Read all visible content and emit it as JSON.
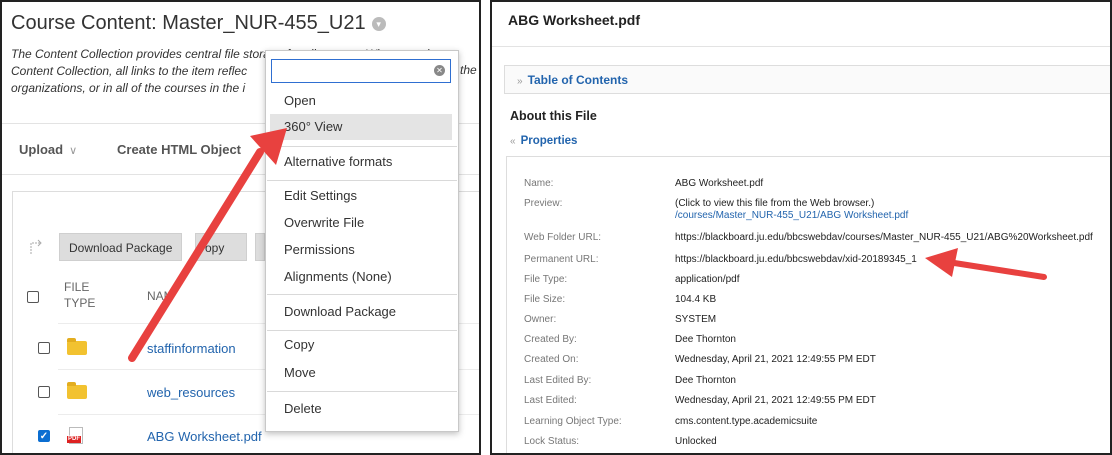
{
  "left_panel": {
    "title": "Course Content: Master_NUR-455_U21",
    "description_lines": [
      "The Content Collection provides central file storage for all content. When creating c",
      "Content Collection, all links to the item reflec",
      "organizations, or in all of the courses in the i"
    ],
    "description_tail_2": "the",
    "toolbar": {
      "upload": "Upload",
      "create_html": "Create HTML Object"
    },
    "actions": {
      "download_package": "Download Package",
      "copy": "opy"
    },
    "table_header": {
      "file_type_1": "FILE",
      "file_type_2": "TYPE",
      "name": "NAM"
    },
    "rows": [
      {
        "name": "staffinformation",
        "type": "folder",
        "checked": false
      },
      {
        "name": "web_resources",
        "type": "folder",
        "checked": false
      },
      {
        "name": "ABG Worksheet.pdf",
        "type": "pdf",
        "checked": true
      }
    ]
  },
  "context_menu": {
    "search_value": "",
    "items": {
      "open": "Open",
      "view_360": "360° View",
      "alternative_formats": "Alternative formats",
      "edit_settings": "Edit Settings",
      "overwrite_file": "Overwrite File",
      "permissions": "Permissions",
      "alignments": "Alignments (None)",
      "download_package": "Download Package",
      "copy": "Copy",
      "move": "Move",
      "delete": "Delete"
    }
  },
  "right_panel": {
    "title": "ABG Worksheet.pdf",
    "toc": "Table of Contents",
    "about": "About this File",
    "properties": "Properties",
    "fields": {
      "name_label": "Name:",
      "name_value": "ABG Worksheet.pdf",
      "preview_label": "Preview:",
      "preview_note": "(Click to view this file from the Web browser.)",
      "preview_link": "/courses/Master_NUR-455_U21/ABG Worksheet.pdf",
      "web_folder_label": "Web Folder URL:",
      "web_folder_value": "https://blackboard.ju.edu/bbcswebdav/courses/Master_NUR-455_U21/ABG%20Worksheet.pdf",
      "permanent_label": "Permanent URL:",
      "permanent_value": "https://blackboard.ju.edu/bbcswebdav/xid-20189345_1",
      "file_type_label": "File Type:",
      "file_type_value": "application/pdf",
      "file_size_label": "File Size:",
      "file_size_value": "104.4 KB",
      "owner_label": "Owner:",
      "owner_value": "SYSTEM",
      "created_by_label": "Created By:",
      "created_by_value": "Dee Thornton",
      "created_on_label": "Created On:",
      "created_on_value": "Wednesday, April 21, 2021 12:49:55 PM EDT",
      "last_edited_by_label": "Last Edited By:",
      "last_edited_by_value": "Dee Thornton",
      "last_edited_label": "Last Edited:",
      "last_edited_value": "Wednesday, April 21, 2021 12:49:55 PM EDT",
      "lo_type_label": "Learning Object Type:",
      "lo_type_value": "cms.content.type.academicsuite",
      "lock_label": "Lock Status:",
      "lock_value": "Unlocked"
    }
  },
  "colors": {
    "link": "#2264ad",
    "arrow": "#e8413f",
    "checkbox": "#0b6ed1"
  }
}
